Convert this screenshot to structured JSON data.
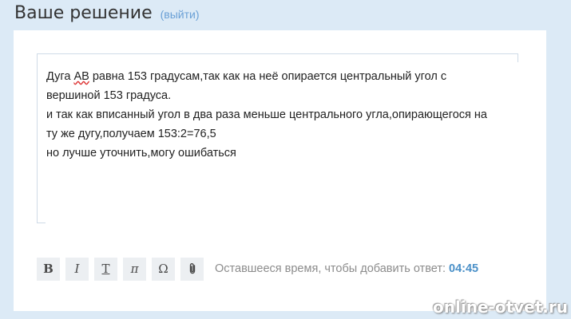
{
  "header": {
    "title": "Ваше решение",
    "logout_link": "(выйти)"
  },
  "answer": {
    "line1_prefix": "Дуга ",
    "line1_underlined": "АВ",
    "line1_suffix": " равна 153 градусам,так как на неё опирается центральный угол с",
    "line2": "вершиной 153 градуса.",
    "line3": "и так как вписанный угол в два раза меньше центрального угла,опирающегося на",
    "line4": "ту же дугу,получаем 153:2=76,5",
    "line5": "но лучше уточнить,могу ошибаться"
  },
  "toolbar": {
    "bold_label": "B",
    "italic_label": "I",
    "strikethrough_label": "T",
    "pi_label": "π",
    "omega_label": "Ω",
    "attachment_icon": "paperclip-icon",
    "timer_text": "Оставшееся время, чтобы добавить ответ:",
    "timer_value": "04:45"
  },
  "watermark": "online-otvet.ru",
  "colors": {
    "background": "#dceaf6",
    "link": "#6aa0d6",
    "timer_value": "#4a90c8",
    "button_bg": "#eceff2"
  }
}
